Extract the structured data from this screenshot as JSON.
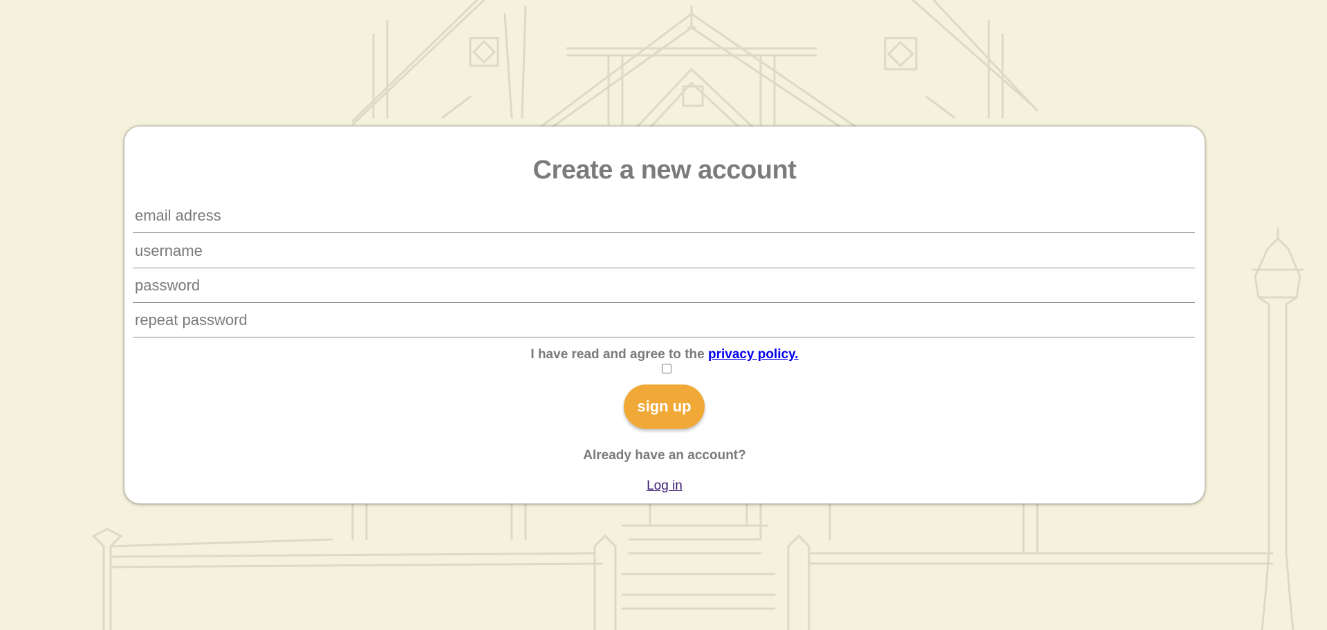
{
  "form": {
    "title": "Create a new account",
    "email_placeholder": "email adress",
    "username_placeholder": "username",
    "password_placeholder": "password",
    "repeat_password_placeholder": "repeat password",
    "agree_text": "I have read and agree to the ",
    "privacy_link": "privacy policy.",
    "signup_label": "sign up",
    "already_text": "Already have an account?",
    "login_link": "Log in"
  },
  "colors": {
    "background": "#f4f2dd",
    "card": "#ffffff",
    "button": "#f0a836",
    "text": "#7a7a7a",
    "link": "#0000ee",
    "visited_link": "#3a1670"
  },
  "icons": {
    "background": "mansion-line-drawing"
  }
}
